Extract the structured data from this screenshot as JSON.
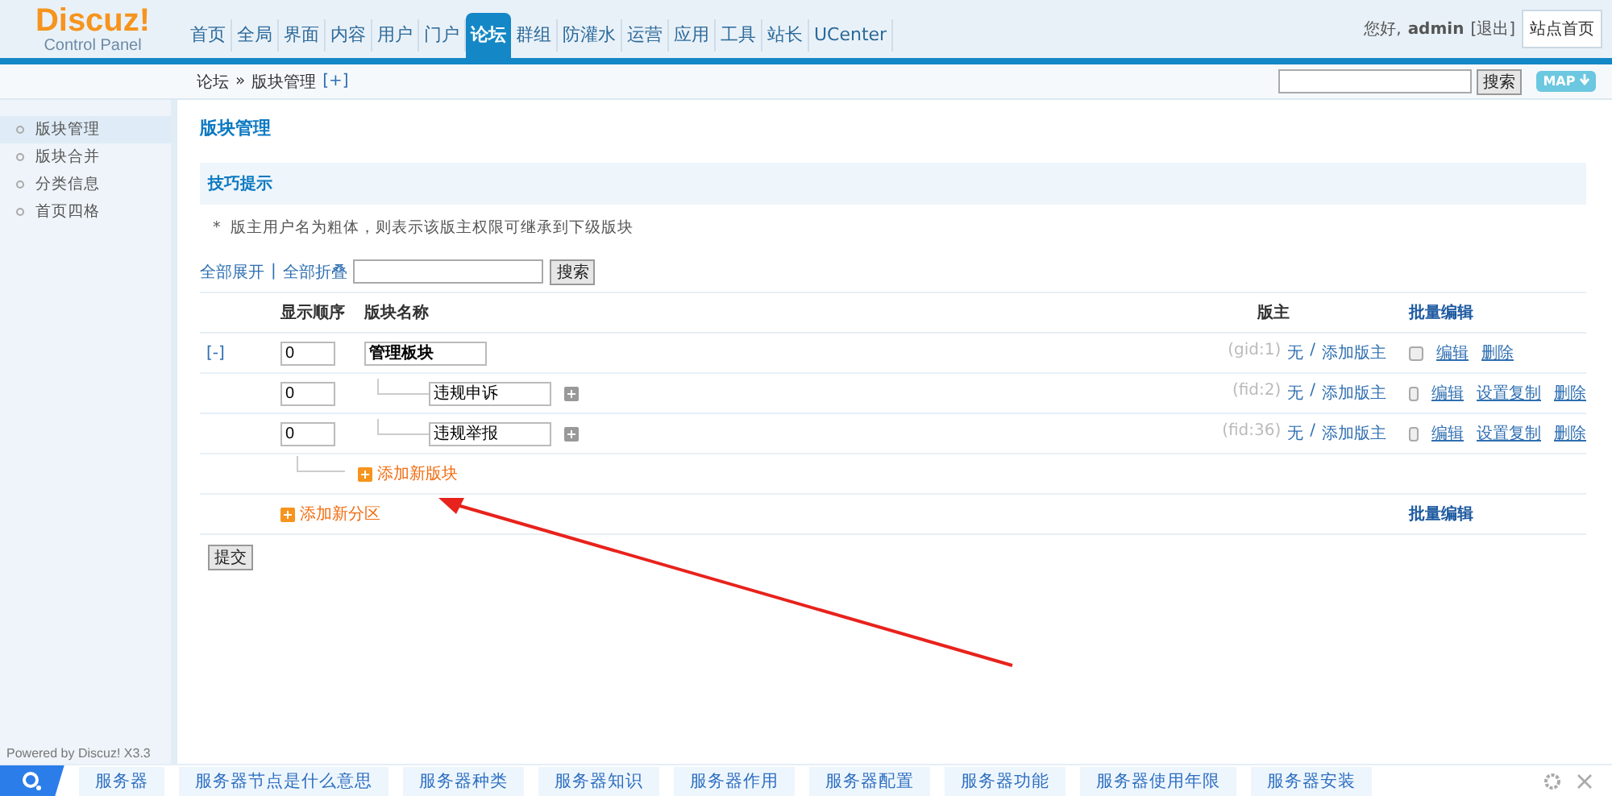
{
  "logo": {
    "title": "Discuz!",
    "subtitle": "Control Panel"
  },
  "nav": [
    {
      "label": "首页",
      "selected": false
    },
    {
      "label": "全局",
      "selected": false
    },
    {
      "label": "界面",
      "selected": false
    },
    {
      "label": "内容",
      "selected": false
    },
    {
      "label": "用户",
      "selected": false
    },
    {
      "label": "门户",
      "selected": false
    },
    {
      "label": "论坛",
      "selected": true
    },
    {
      "label": "群组",
      "selected": false
    },
    {
      "label": "防灌水",
      "selected": false
    },
    {
      "label": "运营",
      "selected": false
    },
    {
      "label": "应用",
      "selected": false
    },
    {
      "label": "工具",
      "selected": false
    },
    {
      "label": "站长",
      "selected": false
    },
    {
      "label": "UCenter",
      "selected": false
    }
  ],
  "user": {
    "greeting": "您好,",
    "name": "admin",
    "logout": "[退出]",
    "home": "站点首页"
  },
  "breadcrumb": {
    "items": [
      "论坛",
      "»",
      "版块管理"
    ],
    "add": "[+]"
  },
  "top_search": {
    "button": "搜索",
    "map": "MAP"
  },
  "sidebar": {
    "items": [
      {
        "label": "版块管理",
        "selected": true
      },
      {
        "label": "版块合并",
        "selected": false
      },
      {
        "label": "分类信息",
        "selected": false
      },
      {
        "label": "首页四格",
        "selected": false
      }
    ],
    "footer": "Powered by Discuz! X3.3"
  },
  "page_title": "版块管理",
  "tips": {
    "title": "技巧提示",
    "bullet": "*",
    "items": [
      "版主用户名为粗体，则表示该版主权限可继承到下级版块"
    ]
  },
  "filter": {
    "expand": "全部展开",
    "separator": "|",
    "collapse": "全部折叠",
    "button": "搜索"
  },
  "table": {
    "columns": [
      "显示顺序",
      "版块名称",
      "版主",
      "批量编辑"
    ],
    "groups": [
      {
        "toggle": "[-]",
        "order": "0",
        "name": "管理板块",
        "id": "(gid:1)",
        "mods": "无",
        "sep": "/",
        "add_mod": "添加版主",
        "checked": false,
        "actions": [
          "编辑",
          "删除"
        ],
        "children": [
          {
            "order": "0",
            "name": "违规申诉",
            "id": "(fid:2)",
            "mods": "无",
            "sep": "/",
            "add_mod": "添加版主",
            "checked": false,
            "actions": [
              "编辑",
              "设置复制",
              "删除"
            ]
          },
          {
            "order": "0",
            "name": "违规举报",
            "id": "(fid:36)",
            "mods": "无",
            "sep": "/",
            "add_mod": "添加版主",
            "checked": false,
            "actions": [
              "编辑",
              "设置复制",
              "删除"
            ]
          }
        ],
        "add_forum": "添加新版块"
      }
    ],
    "add_group": "添加新分区",
    "footer_batch": "批量编辑"
  },
  "submit": "提交",
  "bottom_bar": {
    "links": [
      "服务器",
      "服务器节点是什么意思",
      "服务器种类",
      "服务器知识",
      "服务器作用",
      "服务器配置",
      "服务器功能",
      "服务器使用年限",
      "服务器安装"
    ]
  }
}
